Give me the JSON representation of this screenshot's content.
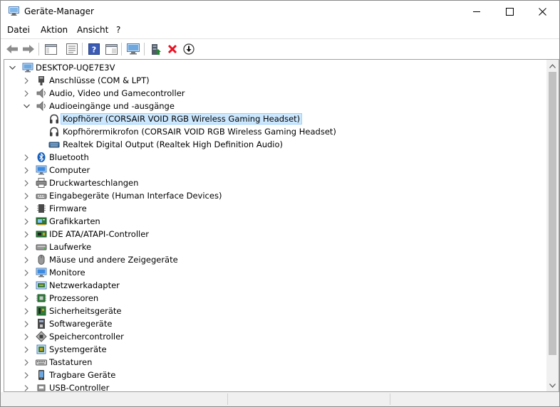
{
  "window": {
    "title": "Geräte-Manager"
  },
  "menu": [
    "Datei",
    "Aktion",
    "Ansicht",
    "?"
  ],
  "toolbar": {
    "buttons": [
      "back-arrow-icon",
      "forward-arrow-icon",
      "show-hide-tree-icon",
      "properties-icon",
      "help-icon",
      "view-icon",
      "monitor-scan-icon",
      "update-driver-icon",
      "uninstall-icon",
      "download-driver-icon"
    ]
  },
  "tree": {
    "root": "DESKTOP-UQE7E3V",
    "categories": [
      {
        "label": "Anschlüsse (COM & LPT)",
        "icon": "port-icon"
      },
      {
        "label": "Audio, Video und Gamecontroller",
        "icon": "speaker-icon"
      },
      {
        "label": "Audioeingänge und -ausgänge",
        "icon": "speaker-icon",
        "expanded": true
      },
      {
        "label": "Bluetooth",
        "icon": "bluetooth-icon"
      },
      {
        "label": "Computer",
        "icon": "computer-icon"
      },
      {
        "label": "Druckwarteschlangen",
        "icon": "printer-icon"
      },
      {
        "label": "Eingabegeräte (Human Interface Devices)",
        "icon": "hid-icon"
      },
      {
        "label": "Firmware",
        "icon": "firmware-icon"
      },
      {
        "label": "Grafikkarten",
        "icon": "display-adapter-icon"
      },
      {
        "label": "IDE ATA/ATAPI-Controller",
        "icon": "ide-controller-icon"
      },
      {
        "label": "Laufwerke",
        "icon": "disk-drive-icon"
      },
      {
        "label": "Mäuse und andere Zeigegeräte",
        "icon": "mouse-icon"
      },
      {
        "label": "Monitore",
        "icon": "monitor-icon"
      },
      {
        "label": "Netzwerkadapter",
        "icon": "network-adapter-icon"
      },
      {
        "label": "Prozessoren",
        "icon": "processor-icon"
      },
      {
        "label": "Sicherheitsgeräte",
        "icon": "security-device-icon"
      },
      {
        "label": "Softwaregeräte",
        "icon": "software-device-icon"
      },
      {
        "label": "Speichercontroller",
        "icon": "storage-controller-icon"
      },
      {
        "label": "Systemgeräte",
        "icon": "system-device-icon"
      },
      {
        "label": "Tastaturen",
        "icon": "keyboard-icon"
      },
      {
        "label": "Tragbare Geräte",
        "icon": "portable-device-icon"
      },
      {
        "label": "USB-Controller",
        "icon": "usb-controller-icon"
      }
    ],
    "audio_children": [
      {
        "label": "Kopfhörer (CORSAIR VOID RGB Wireless Gaming Headset)",
        "icon": "headphones-icon",
        "selected": true
      },
      {
        "label": "Kopfhörermikrofon (CORSAIR VOID RGB Wireless Gaming Headset)",
        "icon": "headphones-icon"
      },
      {
        "label": "Realtek Digital Output (Realtek High Definition Audio)",
        "icon": "digital-output-icon"
      }
    ]
  },
  "colors": {
    "selection_bg": "#cce8ff",
    "selection_border": "#99d1ff",
    "uninstall_red": "#e81123",
    "update_green": "#1e8a2e"
  }
}
